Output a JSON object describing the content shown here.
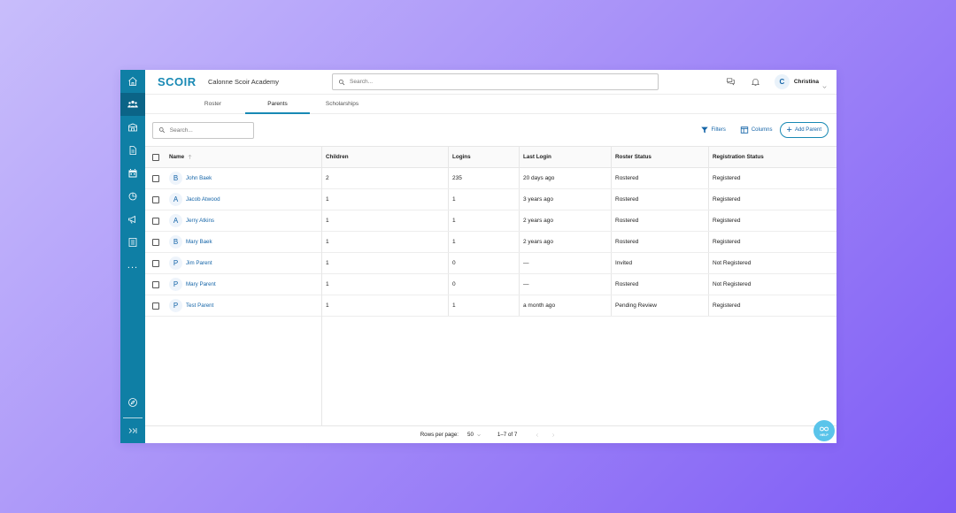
{
  "app": {
    "logo": "SCOIR",
    "school_name": "Calonne Scoir Academy",
    "accent": "#1889b4",
    "sidebar_color": "#0f7fa5"
  },
  "header": {
    "search_placeholder": "Search...",
    "user_initial": "C",
    "user_name": "Christina"
  },
  "sidebar": {
    "items": [
      {
        "icon": "home-icon"
      },
      {
        "icon": "people-icon",
        "active": true
      },
      {
        "icon": "school-icon"
      },
      {
        "icon": "document-icon"
      },
      {
        "icon": "calendar-icon"
      },
      {
        "icon": "chart-icon"
      },
      {
        "icon": "megaphone-icon"
      },
      {
        "icon": "list-icon"
      },
      {
        "icon": "more-icon",
        "label": "..."
      }
    ],
    "bottom": [
      {
        "icon": "compass-icon"
      },
      {
        "icon": "expand-icon"
      }
    ]
  },
  "tabs": [
    {
      "label": "Roster"
    },
    {
      "label": "Parents",
      "active": true
    },
    {
      "label": "Scholarships"
    }
  ],
  "toolbar": {
    "search_placeholder": "Search...",
    "filters_label": "Filters",
    "columns_label": "Columns",
    "add_label": "Add Parent"
  },
  "table": {
    "headers": {
      "name": "Name",
      "children": "Children",
      "logins": "Logins",
      "last_login": "Last Login",
      "roster_status": "Roster Status",
      "registration_status": "Registration Status"
    },
    "rows": [
      {
        "initial": "B",
        "name": "John Baek",
        "children": "2",
        "logins": "235",
        "last_login": "20 days ago",
        "roster_status": "Rostered",
        "registration_status": "Registered"
      },
      {
        "initial": "A",
        "name": "Jacob Atwood",
        "children": "1",
        "logins": "1",
        "last_login": "3 years ago",
        "roster_status": "Rostered",
        "registration_status": "Registered"
      },
      {
        "initial": "A",
        "name": "Jerry Atkins",
        "children": "1",
        "logins": "1",
        "last_login": "2 years ago",
        "roster_status": "Rostered",
        "registration_status": "Registered"
      },
      {
        "initial": "B",
        "name": "Mary Baek",
        "children": "1",
        "logins": "1",
        "last_login": "2 years ago",
        "roster_status": "Rostered",
        "registration_status": "Registered"
      },
      {
        "initial": "P",
        "name": "Jim Parent",
        "children": "1",
        "logins": "0",
        "last_login": "—",
        "roster_status": "Invited",
        "registration_status": "Not Registered"
      },
      {
        "initial": "P",
        "name": "Mary Parent",
        "children": "1",
        "logins": "0",
        "last_login": "—",
        "roster_status": "Rostered",
        "registration_status": "Not Registered"
      },
      {
        "initial": "P",
        "name": "Test Parent",
        "children": "1",
        "logins": "1",
        "last_login": "a month ago",
        "roster_status": "Pending Review",
        "registration_status": "Registered"
      }
    ]
  },
  "footer": {
    "rows_per_page_label": "Rows per page:",
    "rows_per_page_value": "50",
    "range": "1–7 of 7"
  },
  "help": {
    "label": "HELP"
  }
}
